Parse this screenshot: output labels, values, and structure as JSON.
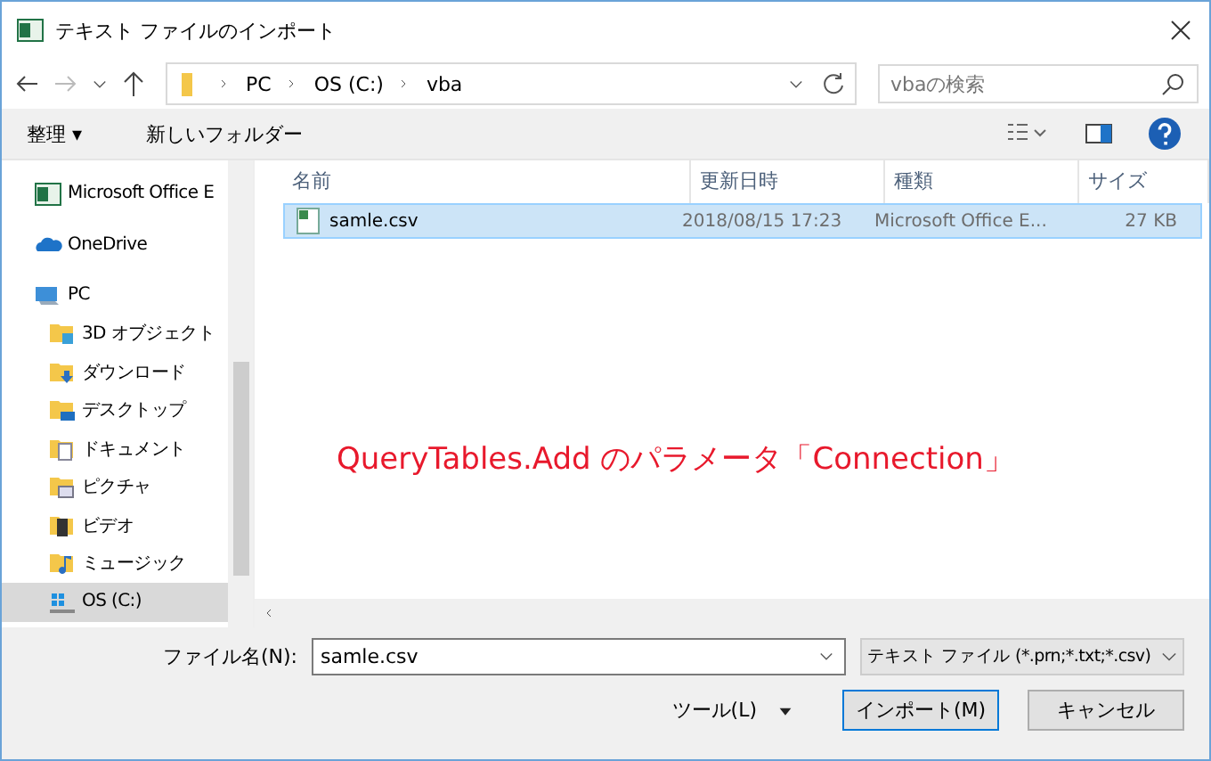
{
  "window": {
    "title": "テキスト ファイルのインポート"
  },
  "address": {
    "path": [
      "PC",
      "OS (C:)",
      "vba"
    ]
  },
  "search": {
    "placeholder": "vbaの検索"
  },
  "toolbar": {
    "items": [
      "整理 ▾",
      "新しいフォルダー"
    ]
  },
  "sidebar": {
    "items": [
      {
        "label": "Microsoft Office E",
        "kind": "excel",
        "selected": false
      },
      {
        "label": "OneDrive",
        "kind": "cloud",
        "selected": false
      },
      {
        "label": "PC",
        "kind": "pc",
        "selected": false,
        "children": [
          {
            "label": "3D オブジェクト",
            "kind": "cube",
            "selected": false
          },
          {
            "label": "ダウンロード",
            "kind": "download",
            "selected": false
          },
          {
            "label": "デスクトップ",
            "kind": "desktop",
            "selected": false
          },
          {
            "label": "ドキュメント",
            "kind": "document",
            "selected": false
          },
          {
            "label": "ピクチャ",
            "kind": "pictures",
            "selected": false
          },
          {
            "label": "ビデオ",
            "kind": "video",
            "selected": false
          },
          {
            "label": "ミュージック",
            "kind": "music",
            "selected": false
          },
          {
            "label": "OS (C:)",
            "kind": "drive",
            "selected": true
          }
        ]
      }
    ]
  },
  "table": {
    "columns": [
      "名前",
      "更新日時",
      "種類",
      "サイズ"
    ],
    "rows": [
      {
        "cells": [
          "samle.csv",
          "2018/08/15 17:23",
          "Microsoft Office E...",
          "27 KB"
        ],
        "selected": true
      }
    ]
  },
  "annotation": "QueryTables.Add のパラメータ「Connection」",
  "footer": {
    "filename_label": "ファイル名(N):",
    "filename": "samle.csv",
    "filetype": "テキスト ファイル (*.prn;*.txt;*.csv)",
    "tools": "ツール(L)",
    "buttons": [
      "インポート(M)",
      "キャンセル"
    ]
  }
}
